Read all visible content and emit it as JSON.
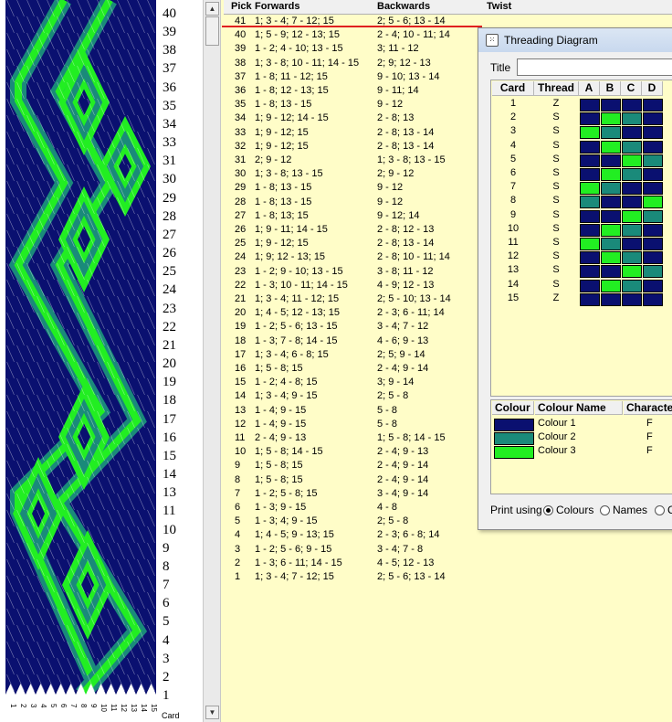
{
  "weave": {
    "colors": {
      "navy": "#0a1070",
      "teal": "#1a8a7a",
      "green": "#22ee22",
      "white": "#ffffff"
    },
    "pick_numbers": [
      "40",
      "39",
      "38",
      "37",
      "36",
      "35",
      "34",
      "33",
      "31",
      "30",
      "29",
      "28",
      "27",
      "26",
      "25",
      "24",
      "23",
      "22",
      "21",
      "20",
      "19",
      "18",
      "17",
      "16",
      "15",
      "14",
      "13",
      "11",
      "10",
      "9",
      "8",
      "7",
      "6",
      "5",
      "4",
      "3",
      "2",
      "1"
    ],
    "card_labels": [
      "1",
      "2",
      "3",
      "4",
      "5",
      "6",
      "7",
      "8",
      "9",
      "10",
      "11",
      "12",
      "13",
      "14",
      "15"
    ],
    "card_axis_label": "Card"
  },
  "picks_table": {
    "headers": {
      "pick": "Pick",
      "forwards": "Forwards",
      "backwards": "Backwards",
      "twist": "Twist"
    },
    "rows": [
      {
        "pick": "41",
        "forwards": "1; 3 - 4; 7 - 12; 15",
        "backwards": "2; 5 - 6; 13 - 14"
      },
      {
        "pick": "40",
        "forwards": "1; 5 - 9; 12 - 13; 15",
        "backwards": "2 - 4; 10 - 11; 14"
      },
      {
        "pick": "39",
        "forwards": "1 - 2; 4 - 10; 13 - 15",
        "backwards": "3; 11 - 12"
      },
      {
        "pick": "38",
        "forwards": "1; 3 - 8; 10 - 11; 14 - 15",
        "backwards": "2; 9; 12 - 13"
      },
      {
        "pick": "37",
        "forwards": "1 - 8; 11 - 12; 15",
        "backwards": "9 - 10; 13 - 14"
      },
      {
        "pick": "36",
        "forwards": "1 - 8; 12 - 13; 15",
        "backwards": "9 - 11; 14"
      },
      {
        "pick": "35",
        "forwards": "1 - 8; 13 - 15",
        "backwards": "9 - 12"
      },
      {
        "pick": "34",
        "forwards": "1; 9 - 12; 14 - 15",
        "backwards": "2 - 8; 13"
      },
      {
        "pick": "33",
        "forwards": "1; 9 - 12; 15",
        "backwards": "2 - 8; 13 - 14"
      },
      {
        "pick": "32",
        "forwards": "1; 9 - 12; 15",
        "backwards": "2 - 8; 13 - 14"
      },
      {
        "pick": "31",
        "forwards": "2; 9 - 12",
        "backwards": "1; 3 - 8; 13 - 15"
      },
      {
        "pick": "30",
        "forwards": "1; 3 - 8; 13 - 15",
        "backwards": "2; 9 - 12"
      },
      {
        "pick": "29",
        "forwards": "1 - 8; 13 - 15",
        "backwards": "9 - 12"
      },
      {
        "pick": "28",
        "forwards": "1 - 8; 13 - 15",
        "backwards": "9 - 12"
      },
      {
        "pick": "27",
        "forwards": "1 - 8; 13; 15",
        "backwards": "9 - 12; 14"
      },
      {
        "pick": "26",
        "forwards": "1; 9 - 11; 14 - 15",
        "backwards": "2 - 8; 12 - 13"
      },
      {
        "pick": "25",
        "forwards": "1; 9 - 12; 15",
        "backwards": "2 - 8; 13 - 14"
      },
      {
        "pick": "24",
        "forwards": "1; 9; 12 - 13; 15",
        "backwards": "2 - 8; 10 - 11; 14"
      },
      {
        "pick": "23",
        "forwards": "1 - 2; 9 - 10; 13 - 15",
        "backwards": "3 - 8; 11 - 12"
      },
      {
        "pick": "22",
        "forwards": "1 - 3; 10 - 11; 14 - 15",
        "backwards": "4 - 9; 12 - 13"
      },
      {
        "pick": "21",
        "forwards": "1; 3 - 4; 11 - 12; 15",
        "backwards": "2; 5 - 10; 13 - 14"
      },
      {
        "pick": "20",
        "forwards": "1; 4 - 5; 12 - 13; 15",
        "backwards": "2 - 3; 6 - 11; 14"
      },
      {
        "pick": "19",
        "forwards": "1 - 2; 5 - 6; 13 - 15",
        "backwards": "3 - 4; 7 - 12"
      },
      {
        "pick": "18",
        "forwards": "1 - 3; 7 - 8; 14 - 15",
        "backwards": "4 - 6; 9 - 13"
      },
      {
        "pick": "17",
        "forwards": "1; 3 - 4; 6 - 8; 15",
        "backwards": "2; 5; 9 - 14"
      },
      {
        "pick": "16",
        "forwards": "1; 5 - 8; 15",
        "backwards": "2 - 4; 9 - 14"
      },
      {
        "pick": "15",
        "forwards": "1 - 2; 4 - 8; 15",
        "backwards": "3; 9 - 14"
      },
      {
        "pick": "14",
        "forwards": "1; 3 - 4; 9 - 15",
        "backwards": "2; 5 - 8"
      },
      {
        "pick": "13",
        "forwards": "1 - 4; 9 - 15",
        "backwards": "5 - 8"
      },
      {
        "pick": "12",
        "forwards": "1 - 4; 9 - 15",
        "backwards": "5 - 8"
      },
      {
        "pick": "11",
        "forwards": "2 - 4; 9 - 13",
        "backwards": "1; 5 - 8; 14 - 15"
      },
      {
        "pick": "10",
        "forwards": "1; 5 - 8; 14 - 15",
        "backwards": "2 - 4; 9 - 13"
      },
      {
        "pick": "9",
        "forwards": "1; 5 - 8; 15",
        "backwards": "2 - 4; 9 - 14"
      },
      {
        "pick": "8",
        "forwards": "1; 5 - 8; 15",
        "backwards": "2 - 4; 9 - 14"
      },
      {
        "pick": "7",
        "forwards": "1 - 2; 5 - 8; 15",
        "backwards": "3 - 4; 9 - 14"
      },
      {
        "pick": "6",
        "forwards": "1 - 3; 9 - 15",
        "backwards": "4 - 8"
      },
      {
        "pick": "5",
        "forwards": "1 - 3; 4; 9 - 15",
        "backwards": "2; 5 - 8"
      },
      {
        "pick": "4",
        "forwards": "1; 4 - 5; 9 - 13; 15",
        "backwards": "2 - 3; 6 - 8; 14"
      },
      {
        "pick": "3",
        "forwards": "1 - 2; 5 - 6; 9 - 15",
        "backwards": "3 - 4; 7 - 8"
      },
      {
        "pick": "2",
        "forwards": "1 - 3; 6 - 11; 14 - 15",
        "backwards": "4 - 5; 12 - 13"
      },
      {
        "pick": "1",
        "forwards": "1; 3 - 4; 7 - 12; 15",
        "backwards": "2; 5 - 6; 13 - 14"
      }
    ]
  },
  "dialog": {
    "title": "Threading Diagram",
    "title_label": "Title",
    "title_value": "",
    "thread_headers": {
      "card": "Card",
      "thread": "Thread",
      "a": "A",
      "b": "B",
      "c": "C",
      "d": "D"
    },
    "cards": [
      {
        "card": "1",
        "thread": "Z",
        "holes": [
          "navy",
          "navy",
          "navy",
          "navy"
        ]
      },
      {
        "card": "2",
        "thread": "S",
        "holes": [
          "navy",
          "green",
          "teal",
          "navy"
        ]
      },
      {
        "card": "3",
        "thread": "S",
        "holes": [
          "green",
          "teal",
          "navy",
          "navy"
        ]
      },
      {
        "card": "4",
        "thread": "S",
        "holes": [
          "navy",
          "green",
          "teal",
          "navy"
        ]
      },
      {
        "card": "5",
        "thread": "S",
        "holes": [
          "navy",
          "navy",
          "green",
          "teal"
        ]
      },
      {
        "card": "6",
        "thread": "S",
        "holes": [
          "navy",
          "green",
          "teal",
          "navy"
        ]
      },
      {
        "card": "7",
        "thread": "S",
        "holes": [
          "green",
          "teal",
          "navy",
          "navy"
        ]
      },
      {
        "card": "8",
        "thread": "S",
        "holes": [
          "teal",
          "navy",
          "navy",
          "green"
        ]
      },
      {
        "card": "9",
        "thread": "S",
        "holes": [
          "navy",
          "navy",
          "green",
          "teal"
        ]
      },
      {
        "card": "10",
        "thread": "S",
        "holes": [
          "navy",
          "green",
          "teal",
          "navy"
        ]
      },
      {
        "card": "11",
        "thread": "S",
        "holes": [
          "green",
          "teal",
          "navy",
          "navy"
        ]
      },
      {
        "card": "12",
        "thread": "S",
        "holes": [
          "navy",
          "green",
          "teal",
          "navy"
        ]
      },
      {
        "card": "13",
        "thread": "S",
        "holes": [
          "navy",
          "navy",
          "green",
          "teal"
        ]
      },
      {
        "card": "14",
        "thread": "S",
        "holes": [
          "navy",
          "green",
          "teal",
          "navy"
        ]
      },
      {
        "card": "15",
        "thread": "Z",
        "holes": [
          "navy",
          "navy",
          "navy",
          "navy"
        ]
      }
    ],
    "colour_headers": {
      "colour": "Colour",
      "name": "Colour Name",
      "character": "Character"
    },
    "colours": [
      {
        "swatch": "navy",
        "name": "Colour 1",
        "character": "F"
      },
      {
        "swatch": "teal",
        "name": "Colour 2",
        "character": "F"
      },
      {
        "swatch": "green",
        "name": "Colour 3",
        "character": "F"
      }
    ],
    "print_using_label": "Print using",
    "print_options": [
      {
        "label": "Colours",
        "selected": true
      },
      {
        "label": "Names",
        "selected": false
      },
      {
        "label": "C",
        "selected": false
      }
    ]
  }
}
